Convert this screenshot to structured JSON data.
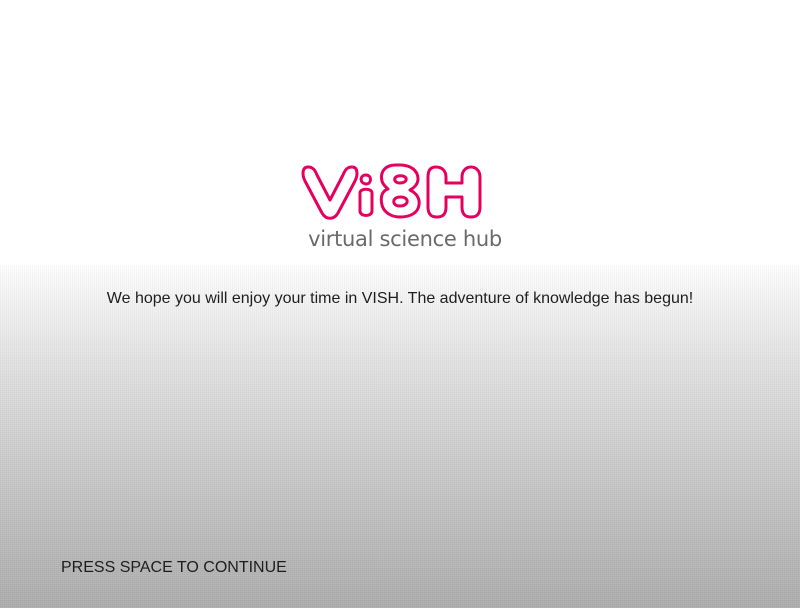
{
  "brand": {
    "logo_text": "VISH",
    "tagline": "virtual science hub",
    "logo_color": "#e5005f"
  },
  "welcome": {
    "message": "We hope you will enjoy your time in VISH. The adventure of knowledge has begun!"
  },
  "prompt": {
    "continue_label": "PRESS SPACE TO CONTINUE"
  }
}
